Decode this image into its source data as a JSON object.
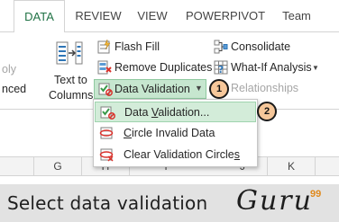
{
  "tabs": [
    "DATA",
    "REVIEW",
    "VIEW",
    "POWERPIVOT",
    "Team"
  ],
  "ribbon": {
    "partial_left_top": "oly",
    "partial_left_bottom": "nced",
    "text_to_columns_line1": "Text to",
    "text_to_columns_line2": "Columns",
    "flash_fill": "Flash Fill",
    "remove_duplicates": "Remove Duplicates",
    "data_validation": "Data Validation",
    "consolidate": "Consolidate",
    "what_if_analysis": "What-If Analysis",
    "relationships": "Relationships"
  },
  "menu": {
    "items": [
      {
        "pre": "Data ",
        "accel": "V",
        "post": "alidation..."
      },
      {
        "pre": "",
        "accel": "C",
        "post": "ircle Invalid Data"
      },
      {
        "pre": "Clear Validation Circle",
        "accel": "s",
        "post": ""
      }
    ]
  },
  "badges": [
    "1",
    "2"
  ],
  "columns": [
    "G",
    "H",
    "I",
    "J",
    "K"
  ],
  "caption": {
    "text": "Select data validation",
    "brand": "Guru",
    "brand_sup": "99"
  },
  "colors": {
    "accent_green": "#217346",
    "badge_fill": "#f6c79a",
    "menu_hover": "#d3ecd9",
    "brand_orange": "#e08a1e"
  }
}
